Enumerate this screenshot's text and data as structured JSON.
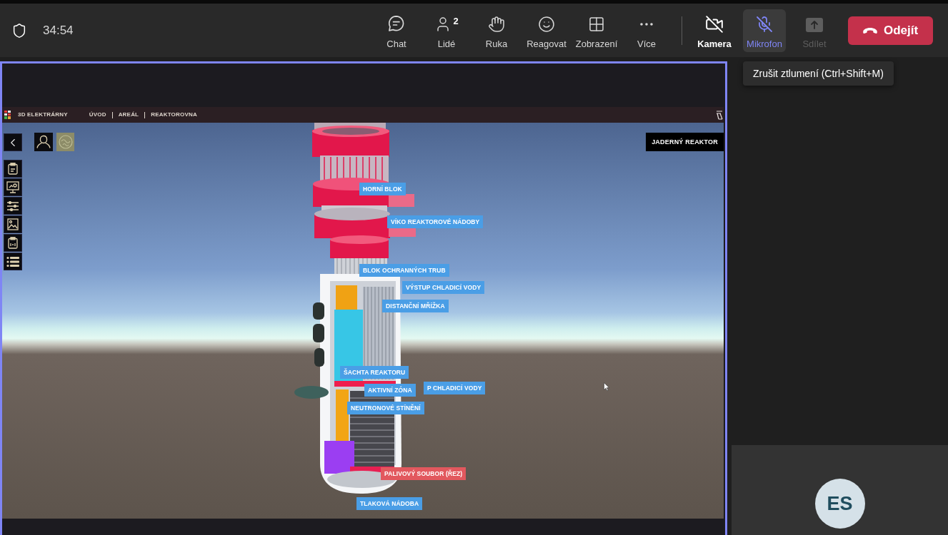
{
  "toolbar": {
    "timer": "34:54",
    "actions": [
      {
        "label": "Chat"
      },
      {
        "label": "Lidé",
        "count": "2"
      },
      {
        "label": "Ruka"
      },
      {
        "label": "Reagovat"
      },
      {
        "label": "Zobrazení"
      },
      {
        "label": "Více"
      }
    ],
    "devices": [
      {
        "kind": "camera",
        "label": "Kamera",
        "on": false,
        "hovered": false,
        "disabled": false
      },
      {
        "kind": "microphone",
        "label": "Mikrofon",
        "on": false,
        "hovered": true,
        "disabled": false
      },
      {
        "kind": "share",
        "label": "Sdílet",
        "hovered": false,
        "disabled": true
      }
    ],
    "leave": {
      "label": "Odejít"
    }
  },
  "tooltip": {
    "text": "Zrušit ztlumení (Ctrl+Shift+M)"
  },
  "shared_screen": {
    "app_title": "3D ELEKTRÁRNY",
    "breadcrumbs": [
      "ÚVOD",
      "AREÁL",
      "REAKTOROVNA"
    ],
    "view_title": "JADERNÝ REAKTOR",
    "labels": [
      {
        "text": "HORNÍ BLOK",
        "color": "#4a9ee6"
      },
      {
        "text": "VÍKO REAKTOROVÉ NÁDOBY",
        "color": "#4a9ee6"
      },
      {
        "text": "BLOK OCHRANNÝCH TRUB",
        "color": "#4a9ee6"
      },
      {
        "text": "VÝSTUP CHLADICÍ VODY",
        "color": "#4a9ee6"
      },
      {
        "text": "DISTANČNÍ MŘÍŽKA",
        "color": "#4a9ee6"
      },
      {
        "text": "ŠACHTA REAKTORU",
        "color": "#4a9ee6"
      },
      {
        "text": "AKTIVNÍ ZÓNA",
        "color": "#4a9ee6"
      },
      {
        "text": "P CHLADICÍ VODY",
        "color": "#4a9ee6"
      },
      {
        "text": "NEUTRONOVÉ STÍNĚNÍ",
        "color": "#4a9ee6"
      },
      {
        "text": "PALIVOVÝ SOUBOR (ŘEZ)",
        "color": "#e2585e"
      },
      {
        "text": "TLAKOVÁ NÁDOBA",
        "color": "#4a9ee6"
      }
    ]
  },
  "participant": {
    "initials": "ES"
  }
}
